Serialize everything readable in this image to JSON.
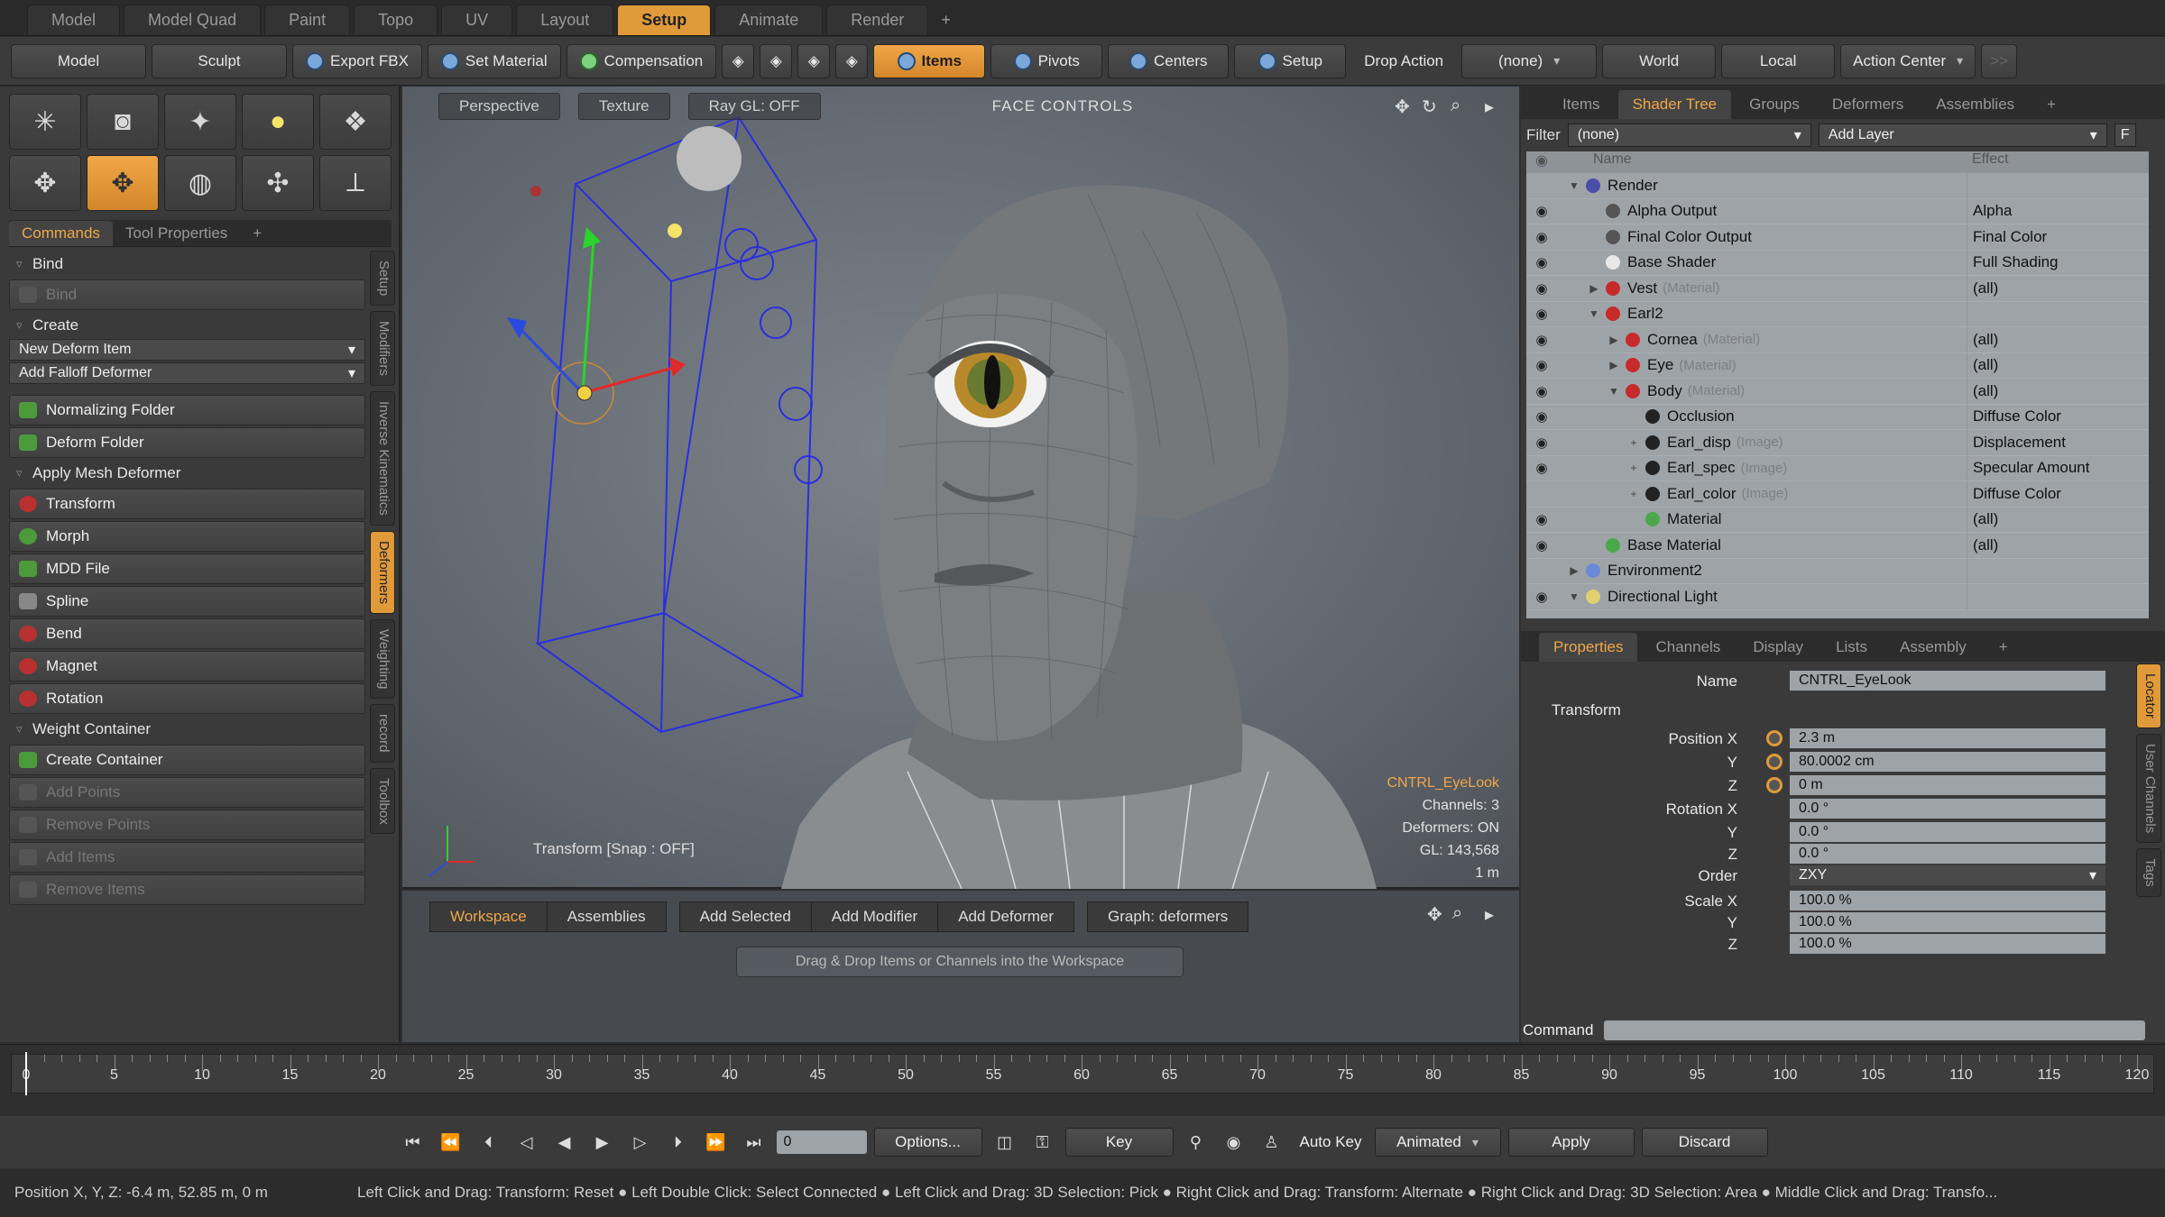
{
  "main_tabs": [
    "Model",
    "Model Quad",
    "Paint",
    "Topo",
    "UV",
    "Layout",
    "Setup",
    "Animate",
    "Render",
    "+"
  ],
  "active_main_tab": "Setup",
  "toolbar": {
    "model": "Model",
    "sculpt": "Sculpt",
    "export_fbx": "Export FBX",
    "set_material": "Set Material",
    "compensation": "Compensation",
    "items": "Items",
    "pivots": "Pivots",
    "centers": "Centers",
    "setup": "Setup",
    "drop_action_label": "Drop Action",
    "drop_action_value": "(none)",
    "world": "World",
    "local": "Local",
    "action_center": "Action Center",
    "more": ">>"
  },
  "left": {
    "tabs": [
      "Commands",
      "Tool Properties",
      "+"
    ],
    "sections": {
      "bind": "Bind",
      "bind_btn": "Bind",
      "create": "Create",
      "new_deform_item": "New Deform Item",
      "add_falloff_deformer": "Add Falloff Deformer",
      "normalizing_folder": "Normalizing Folder",
      "deform_folder": "Deform Folder",
      "apply_mesh_deformer": "Apply Mesh Deformer",
      "transform": "Transform",
      "morph": "Morph",
      "mdd_file": "MDD File",
      "spline": "Spline",
      "bend": "Bend",
      "magnet": "Magnet",
      "rotation": "Rotation",
      "weight_container": "Weight Container",
      "create_container": "Create Container",
      "add_points": "Add Points",
      "remove_points": "Remove Points",
      "add_items": "Add Items",
      "remove_items": "Remove Items"
    },
    "vtabs": [
      "Setup",
      "Modifiers",
      "Inverse Kinematics",
      "Deformers",
      "Weighting",
      "record",
      "Toolbox"
    ]
  },
  "viewport": {
    "perspective": "Perspective",
    "texture": "Texture",
    "raygl": "Ray GL: OFF",
    "title": "FACE CONTROLS",
    "snap": "Transform [Snap : OFF]",
    "info": {
      "item": "CNTRL_EyeLook",
      "channels": "Channels: 3",
      "deformers": "Deformers: ON",
      "gl": "GL: 143,568",
      "scale": "1 m"
    }
  },
  "workspace": {
    "tabs": [
      "Workspace",
      "Assemblies"
    ],
    "actions": [
      "Add Selected",
      "Add Modifier",
      "Add Deformer"
    ],
    "graph": "Graph: deformers",
    "hint": "Drag & Drop Items or Channels into the Workspace"
  },
  "right": {
    "tabs": [
      "Items",
      "Shader Tree",
      "Groups",
      "Deformers",
      "Assemblies",
      "+"
    ],
    "filter_label": "Filter",
    "filter_value": "(none)",
    "add_layer": "Add Layer",
    "f": "F",
    "col_name": "Name",
    "col_effect": "Effect",
    "rows": [
      {
        "name": "Render",
        "sub": "",
        "effect": "",
        "eye": false,
        "tw": "▼",
        "ind": 0,
        "color": "#4a4ea8"
      },
      {
        "name": "Alpha Output",
        "sub": "",
        "effect": "Alpha",
        "eye": true,
        "tw": "",
        "ind": 1,
        "color": "#555"
      },
      {
        "name": "Final Color Output",
        "sub": "",
        "effect": "Final Color",
        "eye": true,
        "tw": "",
        "ind": 1,
        "color": "#555"
      },
      {
        "name": "Base Shader",
        "sub": "",
        "effect": "Full Shading",
        "eye": true,
        "tw": "",
        "ind": 1,
        "color": "#e8e8e8"
      },
      {
        "name": "Vest",
        "sub": "(Material)",
        "effect": "(all)",
        "eye": true,
        "tw": "▶",
        "ind": 1,
        "color": "#c62a2a"
      },
      {
        "name": "Earl2",
        "sub": "",
        "effect": "",
        "eye": true,
        "tw": "▼",
        "ind": 1,
        "color": "#c62a2a"
      },
      {
        "name": "Cornea",
        "sub": "(Material)",
        "effect": "(all)",
        "eye": true,
        "tw": "▶",
        "ind": 2,
        "color": "#c62a2a"
      },
      {
        "name": "Eye",
        "sub": "(Material)",
        "effect": "(all)",
        "eye": true,
        "tw": "▶",
        "ind": 2,
        "color": "#c62a2a"
      },
      {
        "name": "Body",
        "sub": "(Material)",
        "effect": "(all)",
        "eye": true,
        "tw": "▼",
        "ind": 2,
        "color": "#c62a2a"
      },
      {
        "name": "Occlusion",
        "sub": "",
        "effect": "Diffuse Color",
        "eye": true,
        "tw": "",
        "ind": 3,
        "color": "#222"
      },
      {
        "name": "Earl_disp",
        "sub": "(Image)",
        "effect": "Displacement",
        "eye": true,
        "tw": "+",
        "ind": 3,
        "color": "#222"
      },
      {
        "name": "Earl_spec",
        "sub": "(Image)",
        "effect": "Specular Amount",
        "eye": true,
        "tw": "+",
        "ind": 3,
        "color": "#222"
      },
      {
        "name": "Earl_color",
        "sub": "(Image)",
        "effect": "Diffuse Color",
        "eye": false,
        "tw": "+",
        "ind": 3,
        "color": "#222"
      },
      {
        "name": "Material",
        "sub": "",
        "effect": "(all)",
        "eye": true,
        "tw": "",
        "ind": 3,
        "color": "#4aa84a"
      },
      {
        "name": "Base Material",
        "sub": "",
        "effect": "(all)",
        "eye": true,
        "tw": "",
        "ind": 1,
        "color": "#4aa84a"
      },
      {
        "name": "Environment2",
        "sub": "",
        "effect": "",
        "eye": false,
        "tw": "▶",
        "ind": 0,
        "color": "#6a8ad8"
      },
      {
        "name": "Directional Light",
        "sub": "",
        "effect": "",
        "eye": true,
        "tw": "▼",
        "ind": 0,
        "color": "#e0d070"
      }
    ],
    "prop_tabs": [
      "Properties",
      "Channels",
      "Display",
      "Lists",
      "Assembly",
      "+"
    ],
    "props": {
      "name_label": "Name",
      "name_value": "CNTRL_EyeLook",
      "transform": "Transform",
      "position_x_label": "Position X",
      "position_x": "2.3 m",
      "position_y": "80.0002 cm",
      "position_z": "0 m",
      "rotation_x_label": "Rotation X",
      "rotation_x": "0.0 °",
      "rotation_y": "0.0 °",
      "rotation_z": "0.0 °",
      "order_label": "Order",
      "order_value": "ZXY",
      "scale_x_label": "Scale X",
      "scale_x": "100.0 %",
      "scale_y": "100.0 %",
      "scale_z": "100.0 %",
      "y": "Y",
      "z": "Z"
    },
    "prop_vtabs": [
      "Locator",
      "User Channels",
      "Tags"
    ],
    "command_label": "Command"
  },
  "timeline": {
    "labels": [
      0,
      5,
      10,
      15,
      20,
      25,
      30,
      35,
      40,
      45,
      50,
      55,
      60,
      65,
      70,
      75,
      80,
      85,
      90,
      95,
      100,
      105,
      110,
      115,
      120
    ],
    "current_frame": "0"
  },
  "transport": {
    "options": "Options...",
    "key": "Key",
    "auto_key": "Auto Key",
    "animated": "Animated",
    "apply": "Apply",
    "discard": "Discard"
  },
  "status": {
    "position": "Position X, Y, Z:   -6.4 m, 52.85 m, 0 m",
    "hint": "Left Click and Drag: Transform: Reset ● Left Double Click: Select Connected ● Left Click and Drag: 3D Selection: Pick ● Right Click and Drag: Transform: Alternate ● Right Click and Drag: 3D Selection: Area ● Middle Click and Drag: Transfo..."
  }
}
